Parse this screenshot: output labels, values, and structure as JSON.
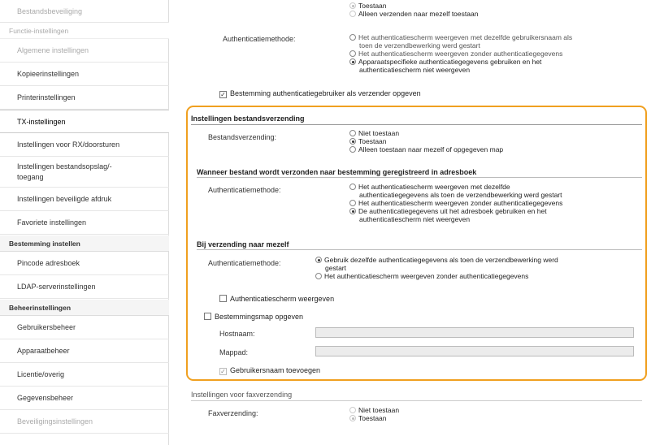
{
  "sidebar": {
    "items": [
      {
        "label": "Bestandsbeveiliging",
        "type": "faded"
      },
      {
        "label": "Functie-instellingen",
        "type": "group-faded"
      },
      {
        "label": "Algemene instellingen",
        "type": "faded"
      },
      {
        "label": "Kopieerinstellingen",
        "type": "item"
      },
      {
        "label": "Printerinstellingen",
        "type": "item"
      },
      {
        "label": "TX-instellingen",
        "type": "selected"
      },
      {
        "label": "Instellingen voor RX/doorsturen",
        "type": "item"
      },
      {
        "label": "Instellingen bestandsopslag/-toegang",
        "type": "item"
      },
      {
        "label": "Instellingen beveiligde afdruk",
        "type": "item"
      },
      {
        "label": "Favoriete instellingen",
        "type": "item"
      },
      {
        "label": "Bestemming instellen",
        "type": "group"
      },
      {
        "label": "Pincode adresboek",
        "type": "item"
      },
      {
        "label": "LDAP-serverinstellingen",
        "type": "item"
      },
      {
        "label": "Beheerinstellingen",
        "type": "group"
      },
      {
        "label": "Gebruikersbeheer",
        "type": "item"
      },
      {
        "label": "Apparaatbeheer",
        "type": "item"
      },
      {
        "label": "Licentie/overig",
        "type": "item"
      },
      {
        "label": "Gegevensbeheer",
        "type": "item"
      },
      {
        "label": "Beveiligingsinstellingen",
        "type": "faded"
      }
    ]
  },
  "top_faded": {
    "opt_a": "Toestaan",
    "opt_b": "Alleen verzenden naar mezelf toestaan",
    "auth_label": "Authenticatiemethode:",
    "auth_opt1_l1": "Het authenticatiescherm weergeven met dezelfde gebruikersnaam als",
    "auth_opt1_l2": "toen de verzendbewerking werd gestart",
    "auth_opt2": "Het authenticatiescherm weergeven zonder authenticatiegegevens",
    "auth_opt3_l1": "Apparaatspecifieke authenticatiegegevens gebruiken en het",
    "auth_opt3_l2": "authenticatiescherm niet weergeven",
    "checkbox_label": "Bestemming authenticatiegebruiker als verzender opgeven"
  },
  "file_tx": {
    "section_title": "Instellingen bestandsverzending",
    "send_label": "Bestandsverzending:",
    "send_options": [
      "Niet toestaan",
      "Toestaan",
      "Alleen toestaan naar mezelf of opgegeven map"
    ],
    "send_selected": 1,
    "addrbook_title": "Wanneer bestand wordt verzonden naar bestemming geregistreerd in adresboek",
    "addrbook_auth_label": "Authenticatiemethode:",
    "addrbook_opt1_l1": "Het authenticatiescherm weergeven met dezelfde",
    "addrbook_opt1_l2": "authenticatiegegevens als toen de verzendbewerking werd gestart",
    "addrbook_opt2": "Het authenticatiescherm weergeven zonder authenticatiegegevens",
    "addrbook_opt3_l1": "De authenticatiegegevens uit het adresboek gebruiken en het",
    "addrbook_opt3_l2": "authenticatiescherm niet weergeven",
    "addrbook_selected": 3,
    "self_title": "Bij verzending naar mezelf",
    "self_auth_label": "Authenticatiemethode:",
    "self_opt1_l1": "Gebruik dezelfde authenticatiegegevens als toen de verzendbewerking werd",
    "self_opt1_l2": "gestart",
    "self_opt2": "Het authenticatiescherm weergeven zonder authenticatiegegevens",
    "self_selected": 1,
    "show_auth_screen": "Authenticatiescherm weergeven",
    "specify_folder": "Bestemmingsmap opgeven",
    "hostname_label": "Hostnaam:",
    "folder_label": "Mappad:",
    "hostname_value": "",
    "folder_value": "",
    "add_username": "Gebruikersnaam toevoegen"
  },
  "fax_tx": {
    "section_title": "Instellingen voor faxverzending",
    "fax_label": "Faxverzending:",
    "fax_options": [
      "Niet toestaan",
      "Toestaan"
    ],
    "fax_selected": 1
  }
}
